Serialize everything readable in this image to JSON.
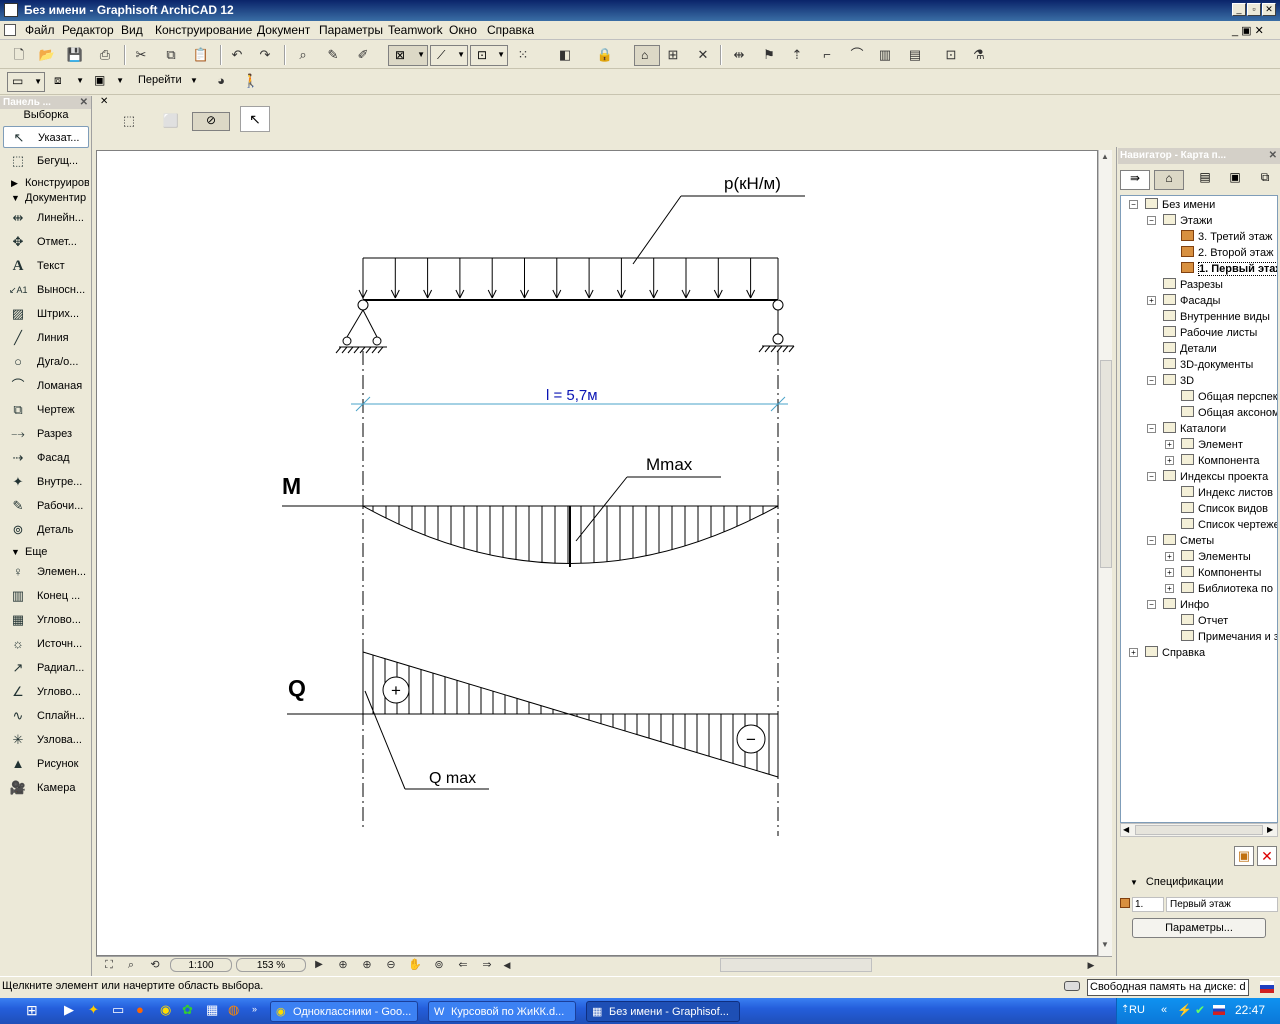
{
  "window": {
    "title": "Без имени - Graphisoft ArchiCAD 12"
  },
  "menu": [
    "Файл",
    "Редактор",
    "Вид",
    "Конструирование",
    "Документ",
    "Параметры",
    "Teamwork",
    "Окно",
    "Справка"
  ],
  "toolbar2": {
    "goto_label": "Перейти"
  },
  "leftpanel": {
    "title": "Панель ...",
    "selection_header": "Выборка",
    "pointer": "Указат...",
    "marquee": "Бегущ...",
    "group_construct": "Конструиров",
    "group_document": "Документир",
    "doc_items": [
      "Линейн...",
      "Отмет...",
      "Текст",
      "Выносн...",
      "Штрих...",
      "Линия",
      "Дуга/о...",
      "Ломаная",
      "Чертеж",
      "Разрез",
      "Фасад",
      "Внутре...",
      "Рабочи...",
      "Деталь"
    ],
    "group_more": "Еще",
    "more_items": [
      "Элемен...",
      "Конец ...",
      "Углово...",
      "Источн...",
      "Радиал...",
      "Углово...",
      "Сплайн...",
      "Узлова...",
      "Рисунок",
      "Камера"
    ]
  },
  "drawing": {
    "load_label": "p(кН/м)",
    "span_label": "l = 5,7м",
    "m_label": "M",
    "mmax_label": "Mmax",
    "q_label": "Q",
    "qmax_label": "Q max",
    "plus_sign": "+",
    "minus_sign": "−"
  },
  "navigator": {
    "title": "Навигатор - Карта п...",
    "tree": [
      {
        "label": "Без имени",
        "level": 0,
        "pm": "−"
      },
      {
        "label": "Этажи",
        "level": 1,
        "pm": "−"
      },
      {
        "label": "3. Третий этаж",
        "level": 2,
        "pm": ""
      },
      {
        "label": "2. Второй этаж",
        "level": 2,
        "pm": ""
      },
      {
        "label": "1. Первый этаж",
        "level": 2,
        "pm": "",
        "bold": true
      },
      {
        "label": "Разрезы",
        "level": 1,
        "pm": ""
      },
      {
        "label": "Фасады",
        "level": 1,
        "pm": "+"
      },
      {
        "label": "Внутренние виды",
        "level": 1,
        "pm": ""
      },
      {
        "label": "Рабочие листы",
        "level": 1,
        "pm": ""
      },
      {
        "label": "Детали",
        "level": 1,
        "pm": ""
      },
      {
        "label": "3D-документы",
        "level": 1,
        "pm": ""
      },
      {
        "label": "3D",
        "level": 1,
        "pm": "−"
      },
      {
        "label": "Общая перспектива",
        "level": 2,
        "pm": ""
      },
      {
        "label": "Общая аксонометрия",
        "level": 2,
        "pm": ""
      },
      {
        "label": "Каталоги",
        "level": 1,
        "pm": "−"
      },
      {
        "label": "Элемент",
        "level": 2,
        "pm": "+"
      },
      {
        "label": "Компонента",
        "level": 2,
        "pm": "+"
      },
      {
        "label": "Индексы проекта",
        "level": 1,
        "pm": "−"
      },
      {
        "label": "Индекс листов",
        "level": 2,
        "pm": ""
      },
      {
        "label": "Список видов",
        "level": 2,
        "pm": ""
      },
      {
        "label": "Список чертежей",
        "level": 2,
        "pm": ""
      },
      {
        "label": "Сметы",
        "level": 1,
        "pm": "−"
      },
      {
        "label": "Элементы",
        "level": 2,
        "pm": "+"
      },
      {
        "label": "Компоненты",
        "level": 2,
        "pm": "+"
      },
      {
        "label": "Библиотека по",
        "level": 2,
        "pm": "+"
      },
      {
        "label": "Инфо",
        "level": 1,
        "pm": "−"
      },
      {
        "label": "Отчет",
        "level": 2,
        "pm": ""
      },
      {
        "label": "Примечания и з",
        "level": 2,
        "pm": ""
      },
      {
        "label": "Справка",
        "level": 0,
        "pm": "+"
      }
    ],
    "spec_label": "Спецификации",
    "spec_num": "1.",
    "spec_value": "Первый этаж",
    "params_button": "Параметры..."
  },
  "bottombar": {
    "scale": "1:100",
    "zoom": "153 %"
  },
  "status": {
    "hint": "Щелкните элемент или начертите область выбора.",
    "disk": "Свободная память на диске: d"
  },
  "taskbar": {
    "tasks": [
      "Одноклассники - Goo...",
      "Курсовой по ЖиКК.d...",
      "Без имени - Graphisof..."
    ],
    "lang": "RU",
    "clock": "22:47"
  }
}
